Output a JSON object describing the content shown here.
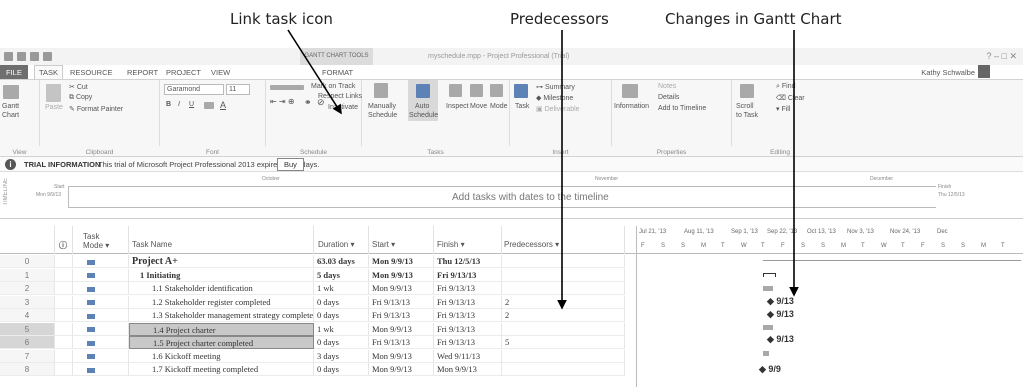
{
  "annotations": {
    "link_task": "Link task icon",
    "predecessors": "Predecessors",
    "gantt_changes": "Changes in Gantt Chart"
  },
  "titlebar": {
    "context_tab": "GANTT CHART TOOLS",
    "document": "myschedule.mpp - Project Professional (Trial)",
    "controls": "?  –  □  ✕"
  },
  "tabs": [
    "FILE",
    "TASK",
    "RESOURCE",
    "REPORT",
    "PROJECT",
    "VIEW",
    "FORMAT"
  ],
  "user": "Kathy Schwalbe",
  "ribbon": {
    "view": {
      "gantt": "Gantt",
      "chart": "Chart",
      "label": "View"
    },
    "clipboard": {
      "paste": "Paste",
      "cut": "Cut",
      "copy": "Copy",
      "format_painter": "Format Painter",
      "label": "Clipboard"
    },
    "font": {
      "family": "Garamond",
      "size": "11",
      "bold": "B",
      "italic": "I",
      "underline": "U",
      "label": "Font"
    },
    "schedule": {
      "mark": "Mark on Track",
      "respect": "Respect Links",
      "inactivate": "Inactivate",
      "label": "Schedule"
    },
    "tasks": {
      "manually": "Manually",
      "manually2": "Schedule",
      "auto": "Auto",
      "auto2": "Schedule",
      "inspect": "Inspect",
      "move": "Move",
      "mode": "Mode",
      "label": "Tasks"
    },
    "insert": {
      "task": "Task",
      "summary": "Summary",
      "milestone": "Milestone",
      "deliverable": "Deliverable",
      "label": "Insert"
    },
    "properties": {
      "information": "Information",
      "notes": "Notes",
      "details": "Details",
      "add_timeline": "Add to Timeline",
      "label": "Properties"
    },
    "editing": {
      "scroll": "Scroll",
      "scroll2": "to Task",
      "find": "Find",
      "clear": "Clear",
      "fill": "Fill",
      "label": "Editing"
    }
  },
  "info": {
    "title": "TRIAL INFORMATION",
    "text": "This trial of Microsoft Project Professional 2013 expires in 48 days.",
    "buy": "Buy"
  },
  "timeline": {
    "label": "TIMELINE",
    "start_l": "Start",
    "start_d": "Mon 9/9/13",
    "finish_l": "Finish",
    "finish_d": "Thu 12/5/13",
    "text": "Add tasks with dates to the timeline",
    "m_oct": "October",
    "m_nov": "November",
    "m_dec": "December"
  },
  "headers": {
    "mode": "Task",
    "mode2": "Mode",
    "name": "Task Name",
    "duration": "Duration",
    "start": "Start",
    "finish": "Finish",
    "pred": "Predecessors"
  },
  "rows": [
    {
      "id": "0",
      "name": "Project A+",
      "duration": "63.03 days",
      "start": "Mon 9/9/13",
      "finish": "Thu 12/5/13",
      "pred": ""
    },
    {
      "id": "1",
      "name": "1 Initiating",
      "duration": "5 days",
      "start": "Mon 9/9/13",
      "finish": "Fri 9/13/13",
      "pred": ""
    },
    {
      "id": "2",
      "name": "1.1 Stakeholder identification",
      "duration": "1 wk",
      "start": "Mon 9/9/13",
      "finish": "Fri 9/13/13",
      "pred": ""
    },
    {
      "id": "3",
      "name": "1.2 Stakeholder register completed",
      "duration": "0 days",
      "start": "Fri 9/13/13",
      "finish": "Fri 9/13/13",
      "pred": "2"
    },
    {
      "id": "4",
      "name": "1.3 Stakeholder management strategy completed",
      "duration": "0 days",
      "start": "Fri 9/13/13",
      "finish": "Fri 9/13/13",
      "pred": "2"
    },
    {
      "id": "5",
      "name": "1.4 Project charter",
      "duration": "1 wk",
      "start": "Mon 9/9/13",
      "finish": "Fri 9/13/13",
      "pred": ""
    },
    {
      "id": "6",
      "name": "1.5 Project charter completed",
      "duration": "0 days",
      "start": "Fri 9/13/13",
      "finish": "Fri 9/13/13",
      "pred": "5"
    },
    {
      "id": "7",
      "name": "1.6 Kickoff meeting",
      "duration": "3 days",
      "start": "Mon 9/9/13",
      "finish": "Wed 9/11/13",
      "pred": ""
    },
    {
      "id": "8",
      "name": "1.7 Kickoff meeting completed",
      "duration": "0 days",
      "start": "Mon 9/9/13",
      "finish": "Mon 9/9/13",
      "pred": ""
    }
  ],
  "gantt": {
    "weeks": [
      "Jul 21, '13",
      "Aug 11, '13",
      "Sep 1, '13",
      "Sep 22, '13",
      "Oct 13, '13",
      "Nov 3, '13",
      "Nov 24, '13",
      "Dec"
    ],
    "days": [
      "F",
      "S",
      "S",
      "M",
      "T",
      "W",
      "T",
      "F",
      "S",
      "S",
      "M",
      "T",
      "W",
      "T",
      "F",
      "S",
      "S",
      "M",
      "T"
    ],
    "ms3": "9/13",
    "ms4": "9/13",
    "ms6": "9/13",
    "ms8": "9/9"
  }
}
